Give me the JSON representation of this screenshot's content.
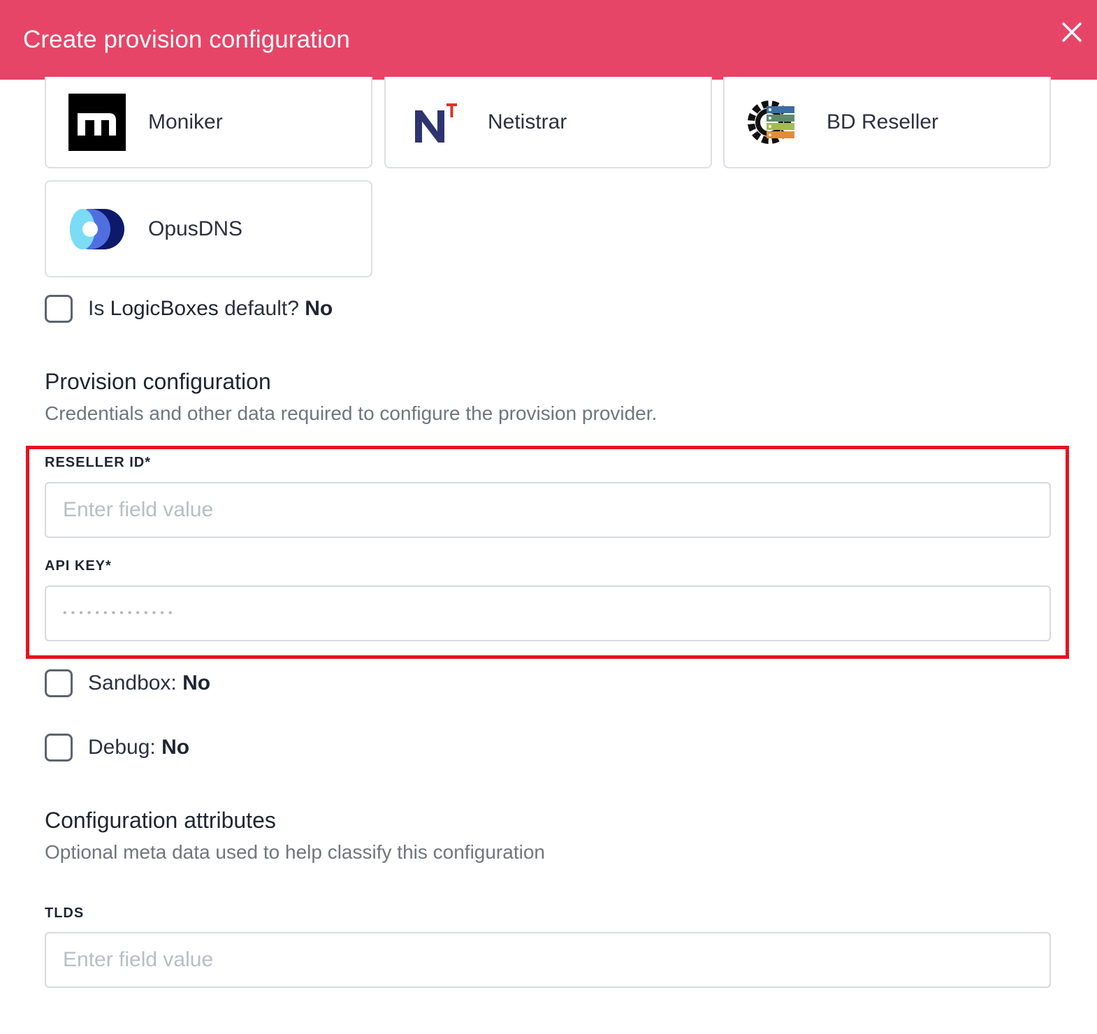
{
  "header": {
    "title": "Create provision configuration"
  },
  "providers": [
    {
      "name": "Moniker",
      "icon": "moniker-logo"
    },
    {
      "name": "Netistrar",
      "icon": "netistrar-logo"
    },
    {
      "name": "BD Reseller",
      "icon": "bd-reseller-logo"
    },
    {
      "name": "OpusDNS",
      "icon": "opusdns-logo"
    }
  ],
  "default_toggle": {
    "prefix": "Is ",
    "bold": "LogicBoxes",
    "suffix": " default? ",
    "value": "No"
  },
  "provision_section": {
    "title": "Provision configuration",
    "description": "Credentials and other data required to configure the provision provider."
  },
  "fields": {
    "reseller_id": {
      "label": "RESELLER ID*",
      "placeholder": "Enter field value",
      "value": ""
    },
    "api_key": {
      "label": "API KEY*",
      "placeholder": "••••••••••••••",
      "value": ""
    }
  },
  "sandbox": {
    "label": "Sandbox: ",
    "value": "No"
  },
  "debug": {
    "label": "Debug: ",
    "value": "No"
  },
  "attributes_section": {
    "title": "Configuration attributes",
    "description": "Optional meta data used to help classify this configuration"
  },
  "tlds": {
    "label": "TLDS",
    "placeholder": "Enter field value",
    "value": ""
  },
  "colors": {
    "header": "#e64568",
    "highlight": "#e8121c"
  }
}
